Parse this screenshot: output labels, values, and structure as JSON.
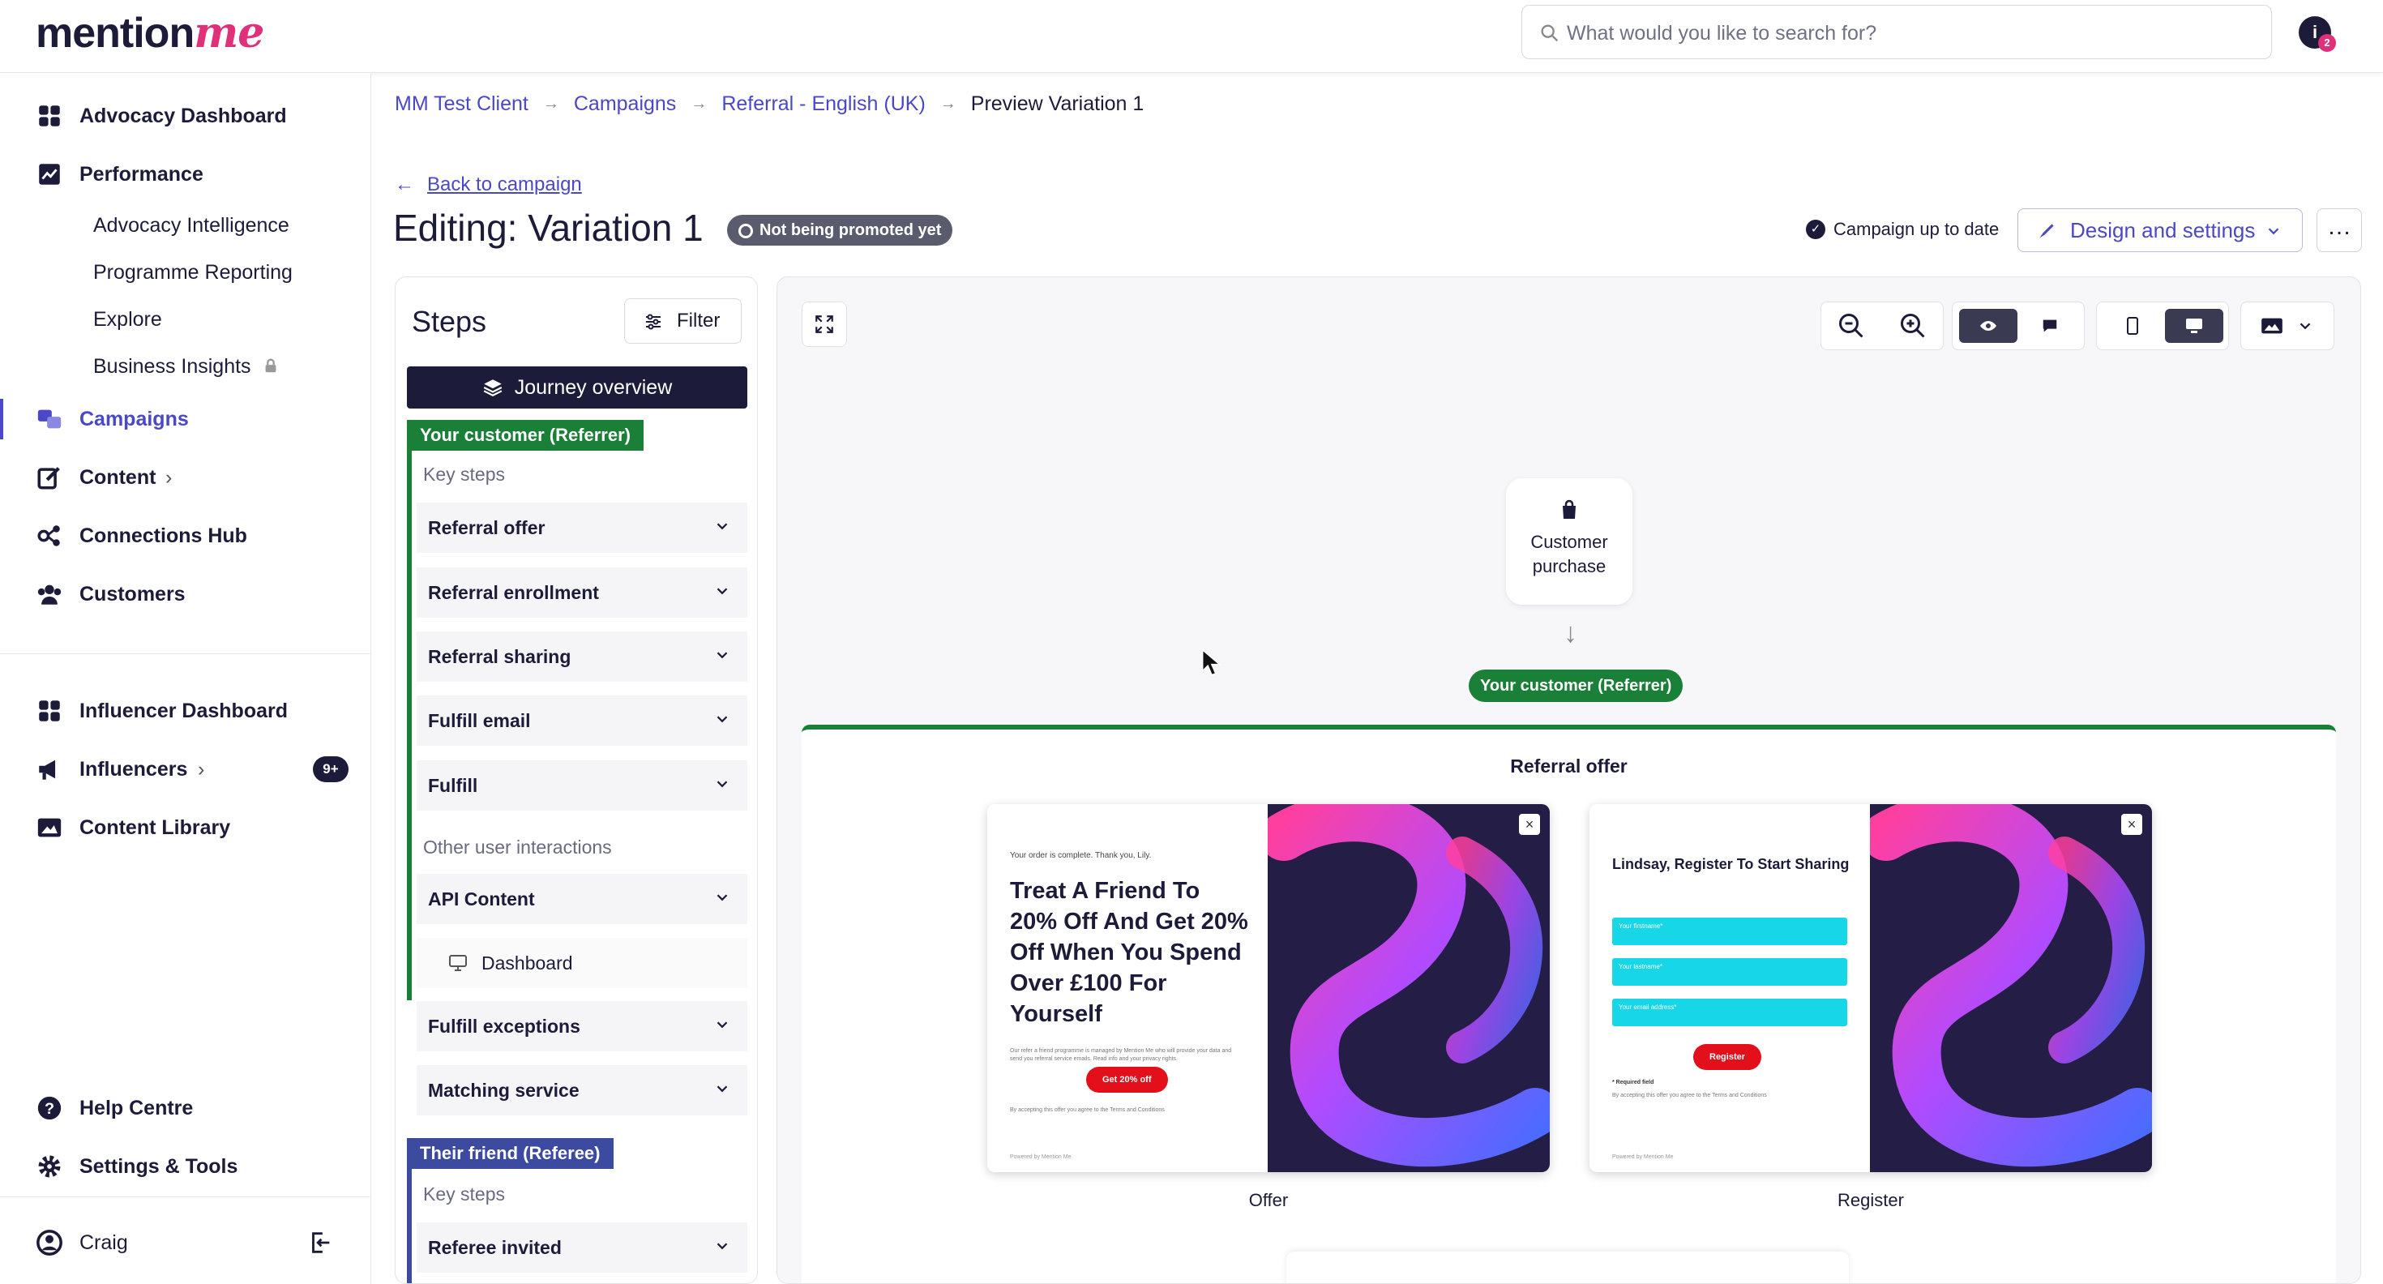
{
  "brand": {
    "logo_main": "mention",
    "logo_accent": "me",
    "accent": "#4b48c7",
    "pink": "#e0307a",
    "navy": "#1d1b3a"
  },
  "search": {
    "placeholder": "What would you like to search for?"
  },
  "user": {
    "avatar_initial": "i",
    "notification_count": "2"
  },
  "sidebar": {
    "advocacy_dashboard": "Advocacy Dashboard",
    "performance": "Performance",
    "performance_sub": [
      "Advocacy Intelligence",
      "Programme Reporting",
      "Explore",
      "Business Insights"
    ],
    "campaigns": "Campaigns",
    "content": "Content",
    "connections_hub": "Connections Hub",
    "customers": "Customers",
    "influencer_dashboard": "Influencer Dashboard",
    "influencers": "Influencers",
    "influencers_badge": "9+",
    "content_library": "Content Library",
    "help_centre": "Help Centre",
    "settings_tools": "Settings & Tools",
    "user_name": "Craig"
  },
  "breadcrumb": [
    "MM Test Client",
    "Campaigns",
    "Referral - English (UK)",
    "Preview Variation 1"
  ],
  "header": {
    "back_link": "Back to campaign",
    "title": "Editing: Variation 1",
    "status_badge": "Not being promoted yet",
    "up_to_date": "Campaign up to date",
    "design_button": "Design and settings"
  },
  "steps": {
    "title": "Steps",
    "filter": "Filter",
    "journey_overview": "Journey overview",
    "referrer_group": "Your customer (Referrer)",
    "key_steps": "Key steps",
    "referrer_steps": [
      "Referral offer",
      "Referral enrollment",
      "Referral sharing",
      "Fulfill email",
      "Fulfill"
    ],
    "other_interactions": "Other user interactions",
    "other_steps": [
      "API Content",
      "Dashboard",
      "Fulfill exceptions",
      "Matching service"
    ],
    "referee_group": "Their friend (Referee)",
    "referee_key_steps": "Key steps",
    "referee_steps": [
      "Referee invited"
    ]
  },
  "canvas": {
    "node_label_1": "Customer",
    "node_label_2": "purchase",
    "referrer_pill": "Your customer (Referrer)",
    "lane_title": "Referral offer",
    "offer_card": {
      "top_text": "Your order is complete. Thank you, Lily.",
      "headline": "Treat A Friend To 20% Off And Get 20% Off When You Spend Over £100 For Yourself",
      "body": "Our refer a friend programme is managed by Mention Me who will provide your data and send you referral service emails. Read info and your privacy rights.",
      "cta": "Get 20% off",
      "terms": "By accepting this offer you agree to the Terms and Conditions",
      "powered": "Powered by Mention Me",
      "label": "Offer"
    },
    "register_card": {
      "headline": "Lindsay, Register To Start Sharing",
      "fields": [
        "Your firstname*",
        "Your lastname*",
        "Your email address*"
      ],
      "cta": "Register",
      "required": "* Required field",
      "terms": "By accepting this offer you agree to the Terms and Conditions",
      "powered": "Powered by Mention Me",
      "label": "Register"
    }
  }
}
